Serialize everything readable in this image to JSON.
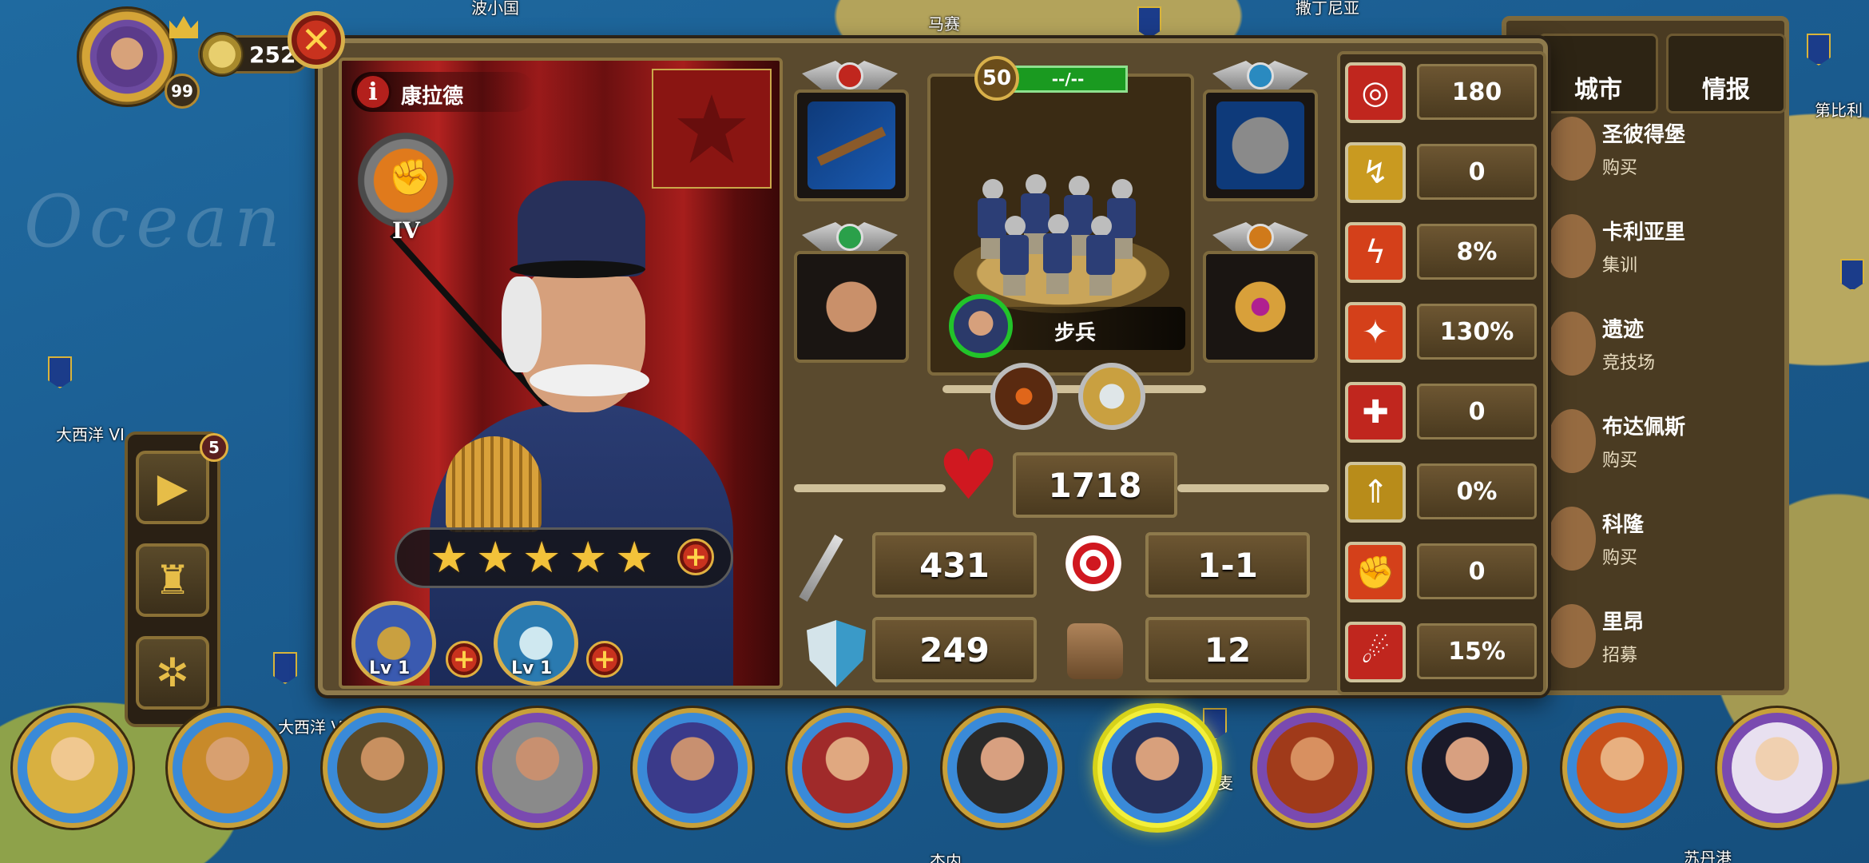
{
  "map": {
    "ocean_text": "Ocean",
    "labels": [
      "波小国",
      "马赛",
      "撒丁尼亚",
      "大西洋 VI",
      "大西洋 V",
      "第比利",
      "苏丹港",
      "杰内",
      "麦"
    ]
  },
  "player": {
    "level": "99",
    "gold": "252"
  },
  "side_menu": {
    "video_badge": "5",
    "items": [
      "video-icon",
      "trophy-icon",
      "settings-icon"
    ]
  },
  "hero": {
    "name": "康拉德",
    "rank_numeral": "IV",
    "stars": 5,
    "skills": [
      {
        "name": "troop-skill",
        "level": "Lv 1"
      },
      {
        "name": "shield-skill",
        "level": "Lv 1"
      }
    ],
    "equipment": {
      "weapon": "musket-icon",
      "armor": "chainmail-icon",
      "boots": "boots-icon",
      "ring": "ring-icon"
    }
  },
  "troop": {
    "level": "50",
    "hp_text": "--/--",
    "unit_name": "步兵"
  },
  "stats": {
    "health": "1718",
    "attack": "431",
    "range": "1-1",
    "defense": "249",
    "movement": "12"
  },
  "attributes": [
    {
      "icon": "target-icon",
      "value": "180",
      "color": "#c0261e"
    },
    {
      "icon": "leg-icon",
      "value": "0",
      "color": "#c99a20"
    },
    {
      "icon": "lightning-icon",
      "value": "8%",
      "color": "#d4401a"
    },
    {
      "icon": "sword-burst-icon",
      "value": "130%",
      "color": "#d4401a"
    },
    {
      "icon": "heal-cross-icon",
      "value": "0",
      "color": "#c0261e"
    },
    {
      "icon": "rank-up-icon",
      "value": "0%",
      "color": "#b88c1a"
    },
    {
      "icon": "fist-icon",
      "value": "0",
      "color": "#d4401a"
    },
    {
      "icon": "rage-icon",
      "value": "15%",
      "color": "#c0261e"
    }
  ],
  "city_panel": {
    "tabs": [
      "城市",
      "情报"
    ],
    "cities": [
      {
        "name": "圣彼得堡",
        "action": "购买"
      },
      {
        "name": "卡利亚里",
        "action": "集训"
      },
      {
        "name": "遗迹",
        "action": "竞技场"
      },
      {
        "name": "布达佩斯",
        "action": "购买"
      },
      {
        "name": "科隆",
        "action": "购买"
      },
      {
        "name": "里昂",
        "action": "招募"
      }
    ]
  },
  "hero_bar": {
    "selected_index": 7,
    "count": 12
  },
  "colors": {
    "panel_bg": "#5a4a2e",
    "panel_border": "#8e7a4c",
    "accent_gold": "#d8b04a",
    "close_red": "#c8321e",
    "hp_green": "#1a9a20"
  }
}
